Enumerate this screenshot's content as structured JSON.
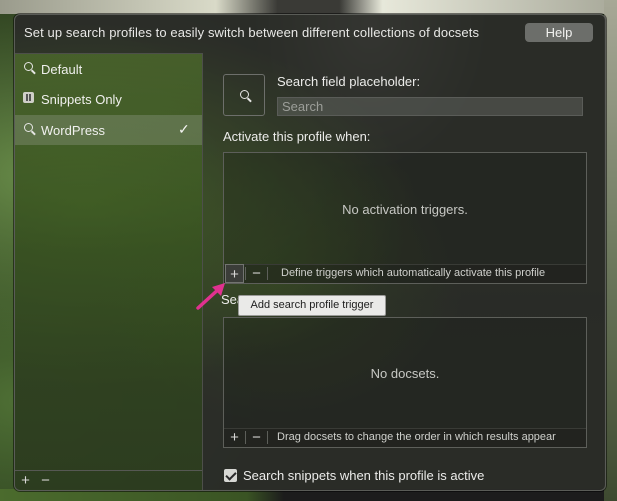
{
  "header": {
    "text": "Set up search profiles to easily switch between different collections of docsets",
    "help_label": "Help"
  },
  "sidebar": {
    "items": [
      {
        "label": "Default",
        "icon": "search-icon",
        "selected": false
      },
      {
        "label": "Snippets Only",
        "icon": "snippet-icon",
        "selected": false
      },
      {
        "label": "WordPress",
        "icon": "search-icon",
        "selected": true
      }
    ],
    "add_label": "+",
    "remove_label": "−"
  },
  "profile": {
    "placeholder_label": "Search field placeholder:",
    "placeholder_input": "Search",
    "activate_label": "Activate this profile when:",
    "triggers_empty": "No activation triggers.",
    "triggers_hint": "Define triggers which automatically activate this profile",
    "docsets_heading_partial": "Sea",
    "docsets_empty": "No docsets.",
    "docsets_hint": "Drag docsets to change the order in which results appear",
    "snippets_checkbox_label": "Search snippets when this profile is active",
    "snippets_checked": true
  },
  "tooltip": {
    "text": "Add search profile trigger"
  },
  "colors": {
    "annotation_arrow": "#e0318f",
    "panel_bg": "#2a2c28"
  }
}
